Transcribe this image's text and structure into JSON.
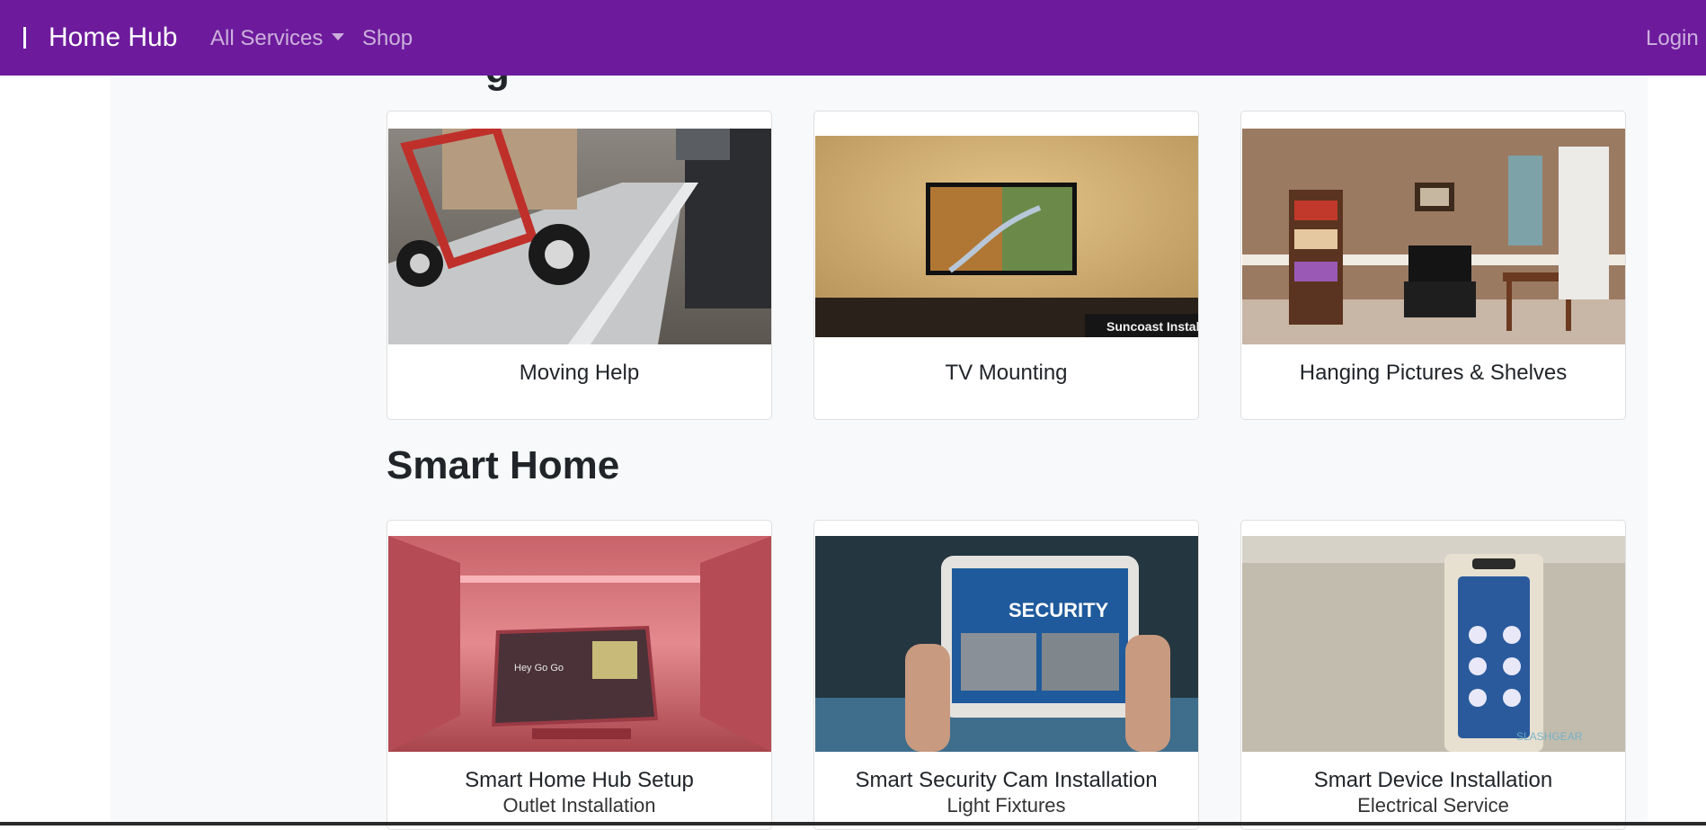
{
  "navbar": {
    "brand": "Home Hub",
    "links": [
      {
        "label": "All Services",
        "dropdown": true
      },
      {
        "label": "Shop"
      }
    ],
    "login": "Login",
    "color": "#6d1b9c"
  },
  "section_above": {
    "partial_heading": "g",
    "cards": [
      {
        "title": "Moving Help",
        "image": "moving-dolly-ramp-photo"
      },
      {
        "title": "TV Mounting",
        "image": "wall-mounted-tv-photo",
        "image_caption": "Suncoast Installs"
      },
      {
        "title": "Hanging Pictures & Shelves",
        "image": "living-room-shelves-photo"
      }
    ]
  },
  "smart_home": {
    "title": "Smart Home",
    "cards": [
      {
        "title": "Smart Home Hub Setup",
        "image": "smart-display-photo",
        "underlying_text": "Outlet Installation",
        "screen_text": "Hey Go Go"
      },
      {
        "title": "Smart Security Cam Installation",
        "image": "security-tablet-photo",
        "underlying_text": "Light Fixtures",
        "screen_text": "SECURITY"
      },
      {
        "title": "Smart Device Installation",
        "image": "wall-smart-panel-photo",
        "underlying_text": "Electrical Service",
        "image_caption": "SLASHGEAR"
      }
    ]
  }
}
